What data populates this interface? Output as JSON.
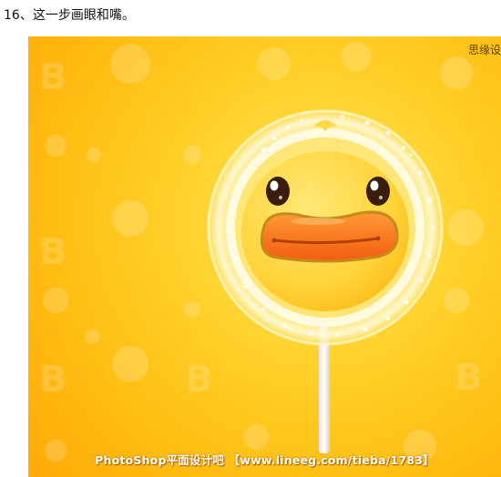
{
  "step": {
    "title": "16、这一步画眼和嘴。"
  },
  "figure": {
    "corner_text": "思缘设",
    "watermark": "PhotoShop平面设计吧 【www.lineeg.com/tieba/1783】",
    "pattern_letter": "B",
    "colors": {
      "background": "#ffc21a",
      "duck_face": "#ffd84a",
      "beak": "#ff7a1f",
      "candy_ring": "#fff3b8"
    }
  }
}
